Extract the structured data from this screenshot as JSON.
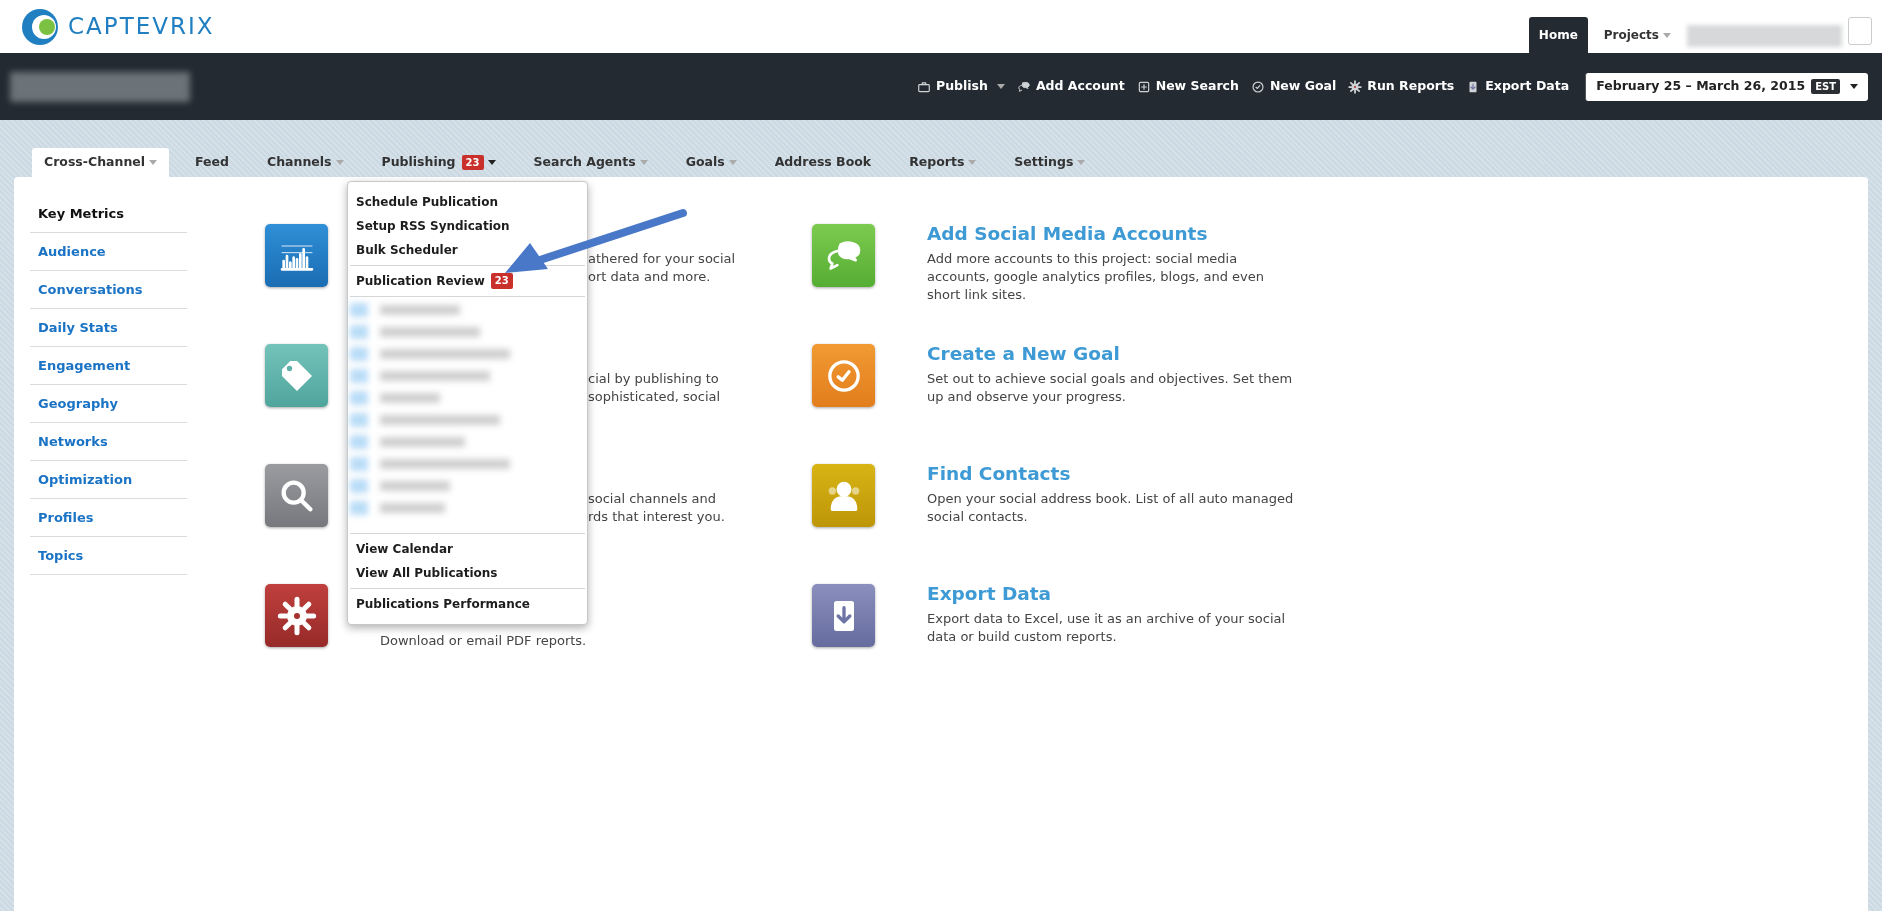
{
  "logo": {
    "text": "CAPTEVRIX"
  },
  "header_tabs": [
    {
      "label": "Home",
      "selected": true,
      "dropdown": false
    },
    {
      "label": "Projects",
      "selected": false,
      "dropdown": true
    }
  ],
  "toolbar": [
    {
      "label": "Publish",
      "kind": "briefcase",
      "dropdown": true
    },
    {
      "label": "Add Account",
      "kind": "chat",
      "dropdown": false
    },
    {
      "label": "New Search",
      "kind": "plus",
      "dropdown": false
    },
    {
      "label": "New Goal",
      "kind": "clock",
      "dropdown": false
    },
    {
      "label": "Run Reports",
      "kind": "gear",
      "dropdown": false
    },
    {
      "label": "Export Data",
      "kind": "download",
      "dropdown": false
    }
  ],
  "date_range": {
    "label": "February 25 – March 26, 2015",
    "timezone": "EST"
  },
  "nav_tabs": [
    {
      "label": "Cross-Channel",
      "selected": true,
      "dropdown": true,
      "open": false
    },
    {
      "label": "Feed",
      "selected": false,
      "dropdown": false
    },
    {
      "label": "Channels",
      "selected": false,
      "dropdown": true,
      "open": false
    },
    {
      "label": "Publishing",
      "selected": false,
      "dropdown": true,
      "open": true,
      "badge": "23"
    },
    {
      "label": "Search Agents",
      "selected": false,
      "dropdown": true,
      "open": false
    },
    {
      "label": "Goals",
      "selected": false,
      "dropdown": true,
      "open": false
    },
    {
      "label": "Address Book",
      "selected": false,
      "dropdown": false
    },
    {
      "label": "Reports",
      "selected": false,
      "dropdown": true,
      "open": false
    },
    {
      "label": "Settings",
      "selected": false,
      "dropdown": true,
      "open": false
    }
  ],
  "sidebar": {
    "items": [
      {
        "label": "Key Metrics",
        "selected": true
      },
      {
        "label": "Audience",
        "selected": false
      },
      {
        "label": "Conversations",
        "selected": false
      },
      {
        "label": "Daily Stats",
        "selected": false
      },
      {
        "label": "Engagement",
        "selected": false
      },
      {
        "label": "Geography",
        "selected": false
      },
      {
        "label": "Networks",
        "selected": false
      },
      {
        "label": "Optimization",
        "selected": false
      },
      {
        "label": "Profiles",
        "selected": false
      },
      {
        "label": "Topics",
        "selected": false
      }
    ]
  },
  "publishing_menu": {
    "sections": [
      {
        "kind": "items",
        "items": [
          {
            "label": "Schedule Publication"
          },
          {
            "label": "Setup RSS Syndication"
          },
          {
            "label": "Bulk Scheduler"
          }
        ]
      },
      {
        "kind": "items",
        "items": [
          {
            "label": "Publication Review",
            "badge": "23"
          }
        ]
      },
      {
        "kind": "redacted"
      },
      {
        "kind": "items",
        "items": [
          {
            "label": "View Calendar"
          },
          {
            "label": "View All Publications"
          }
        ]
      },
      {
        "kind": "items",
        "items": [
          {
            "label": "Publications Performance"
          }
        ]
      }
    ]
  },
  "left_cards": [
    {
      "kind": "chart",
      "lines": [
        "athered for your social",
        "ort data and more."
      ]
    },
    {
      "kind": "tag",
      "lines": [
        "cial by publishing to",
        "sophisticated, social"
      ]
    },
    {
      "kind": "search",
      "lines": [
        "social channels and",
        "rds that interest you."
      ]
    },
    {
      "kind": "gear",
      "lines": [
        "Download or email PDF reports."
      ]
    }
  ],
  "right_cards": [
    {
      "kind": "chat",
      "title": "Add Social Media Accounts",
      "description": "Add more accounts to this project: social media accounts, google analytics profiles, blogs, and even short link sites."
    },
    {
      "kind": "clock",
      "title": "Create a New Goal",
      "description": "Set out to achieve social goals and objectives. Set them up and observe your progress."
    },
    {
      "kind": "contacts",
      "title": "Find Contacts",
      "description": "Open your social address book. List of all auto managed social contacts."
    },
    {
      "kind": "download",
      "title": "Export Data",
      "description": "Export data to Excel, use it as an archive of your social data or build custom reports."
    }
  ]
}
